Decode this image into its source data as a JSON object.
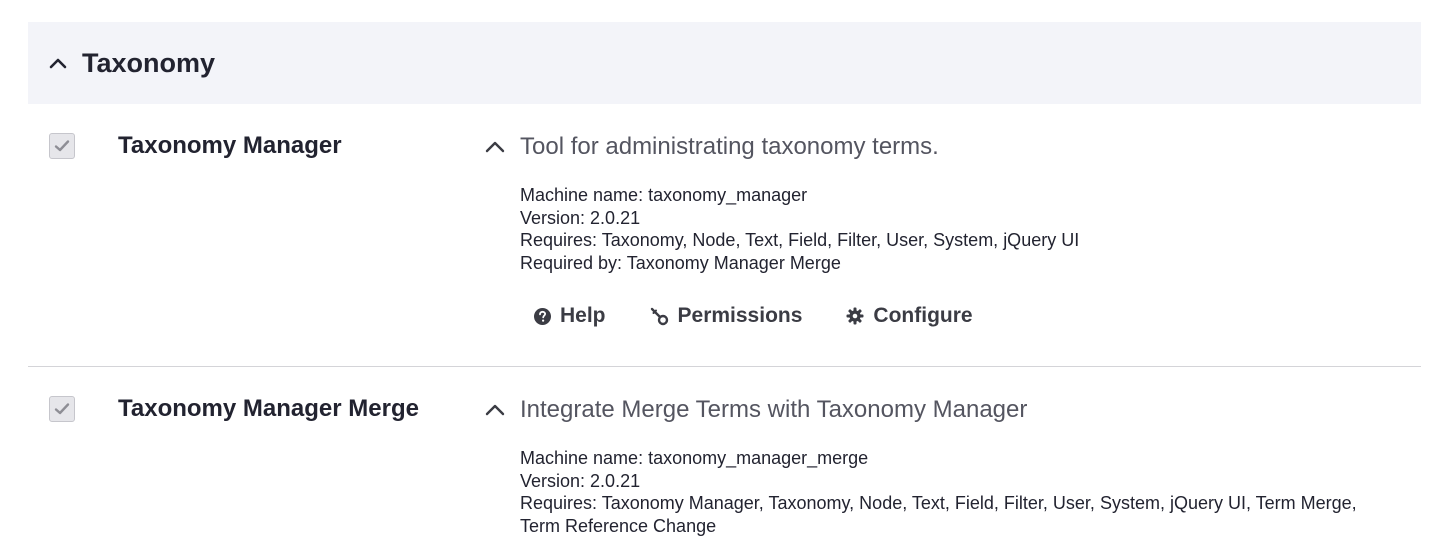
{
  "group": {
    "title": "Taxonomy"
  },
  "modules": [
    {
      "name": "Taxonomy Manager",
      "description": "Tool for administrating taxonomy terms.",
      "machine_name": "Machine name: taxonomy_manager",
      "version": "Version: 2.0.21",
      "requires": "Requires: Taxonomy, Node, Text, Field, Filter, User, System, jQuery UI",
      "required_by": "Required by: Taxonomy Manager Merge",
      "links": {
        "help": "Help",
        "permissions": "Permissions",
        "configure": "Configure"
      }
    },
    {
      "name": "Taxonomy Manager Merge",
      "description": "Integrate Merge Terms with Taxonomy Manager",
      "machine_name": "Machine name: taxonomy_manager_merge",
      "version": "Version: 2.0.21",
      "requires_line1": "Requires: Taxonomy Manager, Taxonomy, Node, Text, Field, Filter, User, System, jQuery UI, Term Merge,",
      "requires_line2": "Term Reference Change"
    }
  ],
  "colors": {
    "header_bg": "#f3f4f9",
    "text": "#222330",
    "muted": "#545560",
    "checkbox_bg": "#e6e6ea",
    "divider": "#d4d4d8"
  },
  "icons": {
    "collapse": "chevron-up-icon",
    "check": "check-icon",
    "help": "question-circle-icon",
    "permissions": "key-icon",
    "configure": "gear-icon"
  }
}
